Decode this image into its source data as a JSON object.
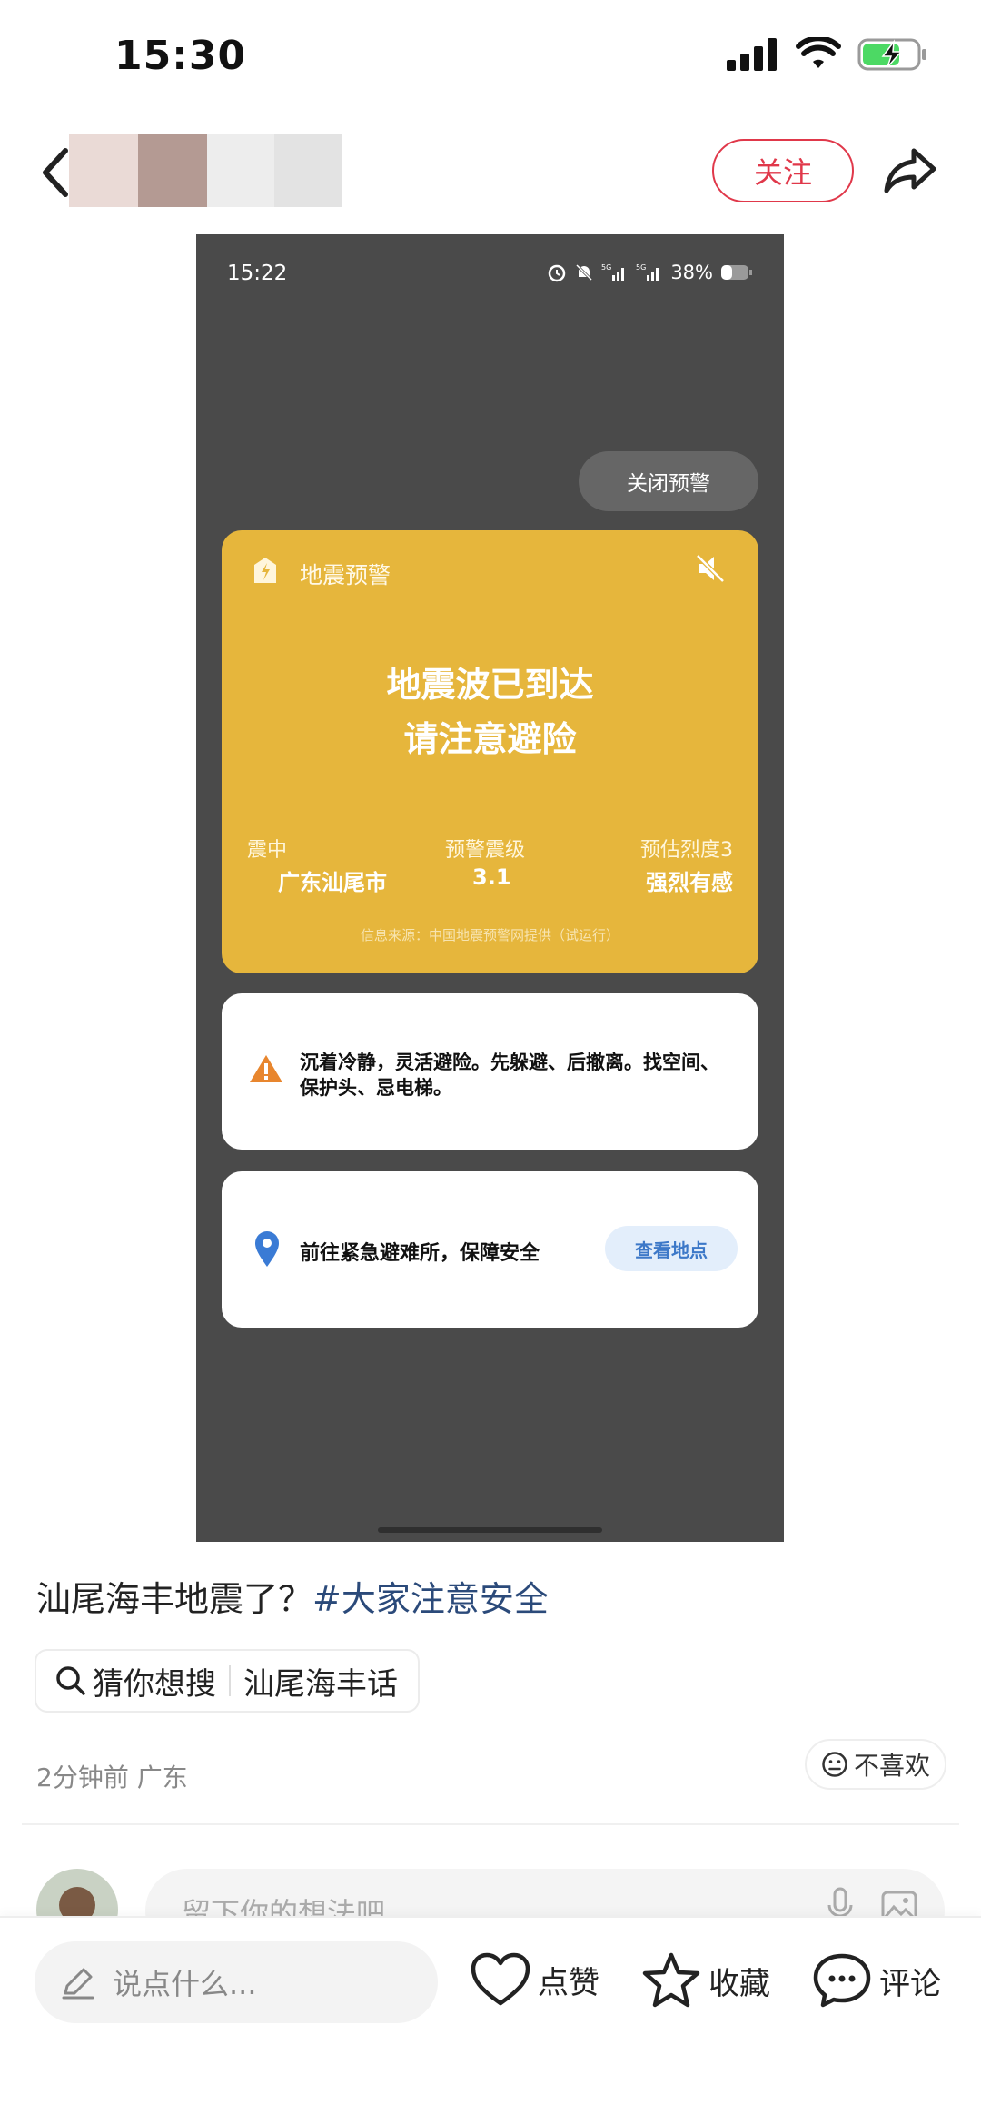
{
  "status_bar": {
    "time": "15:30"
  },
  "header": {
    "follow_label": "关注"
  },
  "screenshot": {
    "time": "15:22",
    "battery": "38%",
    "close_alert_label": "关闭预警",
    "alert": {
      "title": "地震预警",
      "headline_1": "地震波已到达",
      "headline_2": "请注意避险",
      "col1_label": "震中",
      "col1_value": "广东汕尾市",
      "col2_label": "预警震级",
      "col2_value": "3.1",
      "col3_label": "预估烈度3",
      "col3_value": "强烈有感",
      "source": "信息来源：中国地震预警网提供（试运行）"
    },
    "tip_text": "沉着冷静，灵活避险。先躲避、后撤离。找空间、保护头、忌电梯。",
    "shelter_text": "前往紧急避难所，保障安全",
    "view_location_label": "查看地点",
    "colors": {
      "alert_yellow": "#e6b63c",
      "background": "#4a4a4a"
    }
  },
  "post": {
    "title_text": "汕尾海丰地震了？",
    "hashtag": "#大家注意安全",
    "guess_label": "猜你想搜",
    "guess_query": "汕尾海丰话",
    "meta": "2分钟前 广东",
    "dislike_label": "不喜欢"
  },
  "comment": {
    "placeholder": "留下你的想法吧"
  },
  "bottom_bar": {
    "say_placeholder": "说点什么...",
    "like_label": "点赞",
    "collect_label": "收藏",
    "comment_label": "评论"
  },
  "colors": {
    "accent_red": "#e0384a",
    "hashtag_blue": "#2b4a7a"
  }
}
